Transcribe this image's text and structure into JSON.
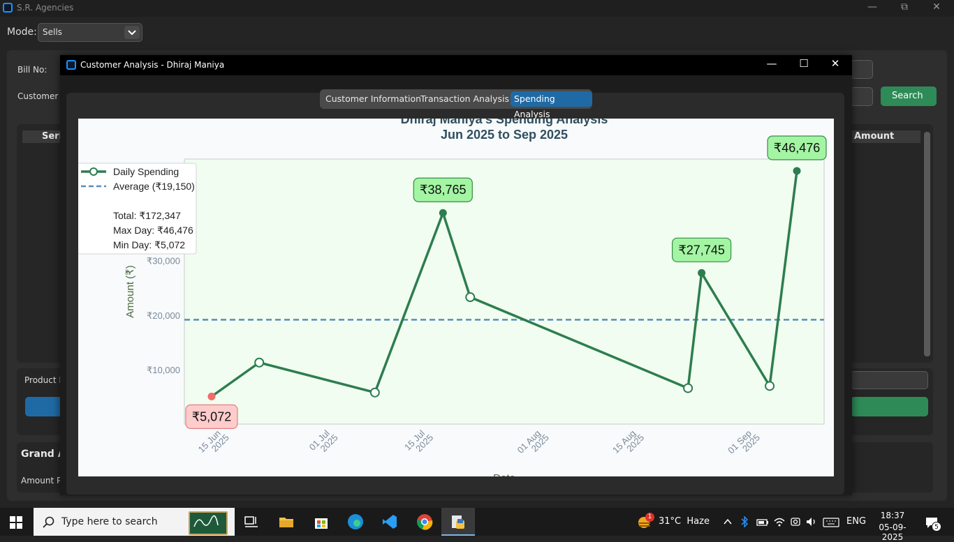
{
  "app": {
    "title": "S.R. Agencies"
  },
  "mode": {
    "label": "Mode:",
    "value": "Sells"
  },
  "background": {
    "bill_no_label": "Bill No:",
    "customer_label": "Customer I",
    "search_button": "Search",
    "serial_header": "Seri",
    "amount_header": "Amount",
    "product_label": "Product N",
    "grand_label": "Grand A",
    "amount_paid_label": "Amount P"
  },
  "dialog": {
    "title": "Customer Analysis - Dhiraj Maniya",
    "tabs": [
      {
        "label": "Customer Information",
        "active": false
      },
      {
        "label": "Transaction Analysis",
        "active": false
      },
      {
        "label": "Spending Analysis",
        "active": true
      }
    ]
  },
  "chart_data": {
    "type": "line",
    "title": "Dhiraj Maniya's Spending Analysis",
    "subtitle": "Jun 2025 to Sep 2025",
    "ylabel": "Amount (₹)",
    "xlabel": "Date",
    "ylim": [
      0,
      46476
    ],
    "y_ticks": [
      "₹10,000",
      "₹20,000",
      "₹30,000"
    ],
    "y_tick_values": [
      10000,
      20000,
      30000
    ],
    "x_ticks": [
      {
        "date": "2025-06-15",
        "label1": "15 Jun",
        "label2": "2025"
      },
      {
        "date": "2025-07-01",
        "label1": "01 Jul",
        "label2": "2025"
      },
      {
        "date": "2025-07-15",
        "label1": "15 Jul",
        "label2": "2025"
      },
      {
        "date": "2025-08-01",
        "label1": "01 Aug",
        "label2": "2025"
      },
      {
        "date": "2025-08-15",
        "label1": "15 Aug",
        "label2": "2025"
      },
      {
        "date": "2025-09-01",
        "label1": "01 Sep",
        "label2": "2025"
      }
    ],
    "x_range": [
      "2025-06-10",
      "2025-09-12"
    ],
    "points": [
      {
        "date": "2025-06-14",
        "value": 5072,
        "kind": "min"
      },
      {
        "date": "2025-06-21",
        "value": 11300,
        "kind": "normal"
      },
      {
        "date": "2025-07-08",
        "value": 5800,
        "kind": "normal"
      },
      {
        "date": "2025-07-18",
        "value": 38765,
        "kind": "peak"
      },
      {
        "date": "2025-07-22",
        "value": 23300,
        "kind": "normal"
      },
      {
        "date": "2025-08-23",
        "value": 6600,
        "kind": "normal"
      },
      {
        "date": "2025-08-25",
        "value": 27745,
        "kind": "peak"
      },
      {
        "date": "2025-09-04",
        "value": 7000,
        "kind": "normal"
      },
      {
        "date": "2025-09-08",
        "value": 46476,
        "kind": "peak"
      }
    ],
    "annotations": [
      {
        "date": "2025-06-14",
        "value": 5072,
        "text": "₹5,072",
        "style": "min"
      },
      {
        "date": "2025-07-18",
        "value": 38765,
        "text": "₹38,765",
        "style": "peak"
      },
      {
        "date": "2025-08-25",
        "value": 27745,
        "text": "₹27,745",
        "style": "peak"
      },
      {
        "date": "2025-09-08",
        "value": 46476,
        "text": "₹46,476",
        "style": "peak"
      }
    ],
    "average": 19150,
    "legend": {
      "position": "top-left",
      "series_label": "Daily Spending",
      "average_label": "Average (₹19,150)",
      "total": "Total: ₹172,347",
      "max_day": "Max Day: ₹46,476",
      "min_day": "Min Day: ₹5,072"
    },
    "colors": {
      "line": "#2e7d4f",
      "average": "#5b8db8",
      "plot_bg": "#f0fdf0",
      "peak_box": "#a3f5a3",
      "min_box": "#ffcccc",
      "min_dot": "#f26a6a"
    },
    "grid": false
  },
  "taskbar": {
    "search_placeholder": "Type here to search",
    "weather": "31°C  Haze",
    "lang": "ENG",
    "time": "18:37",
    "date": "05-09-2025",
    "notif_count": "5",
    "weather_badge": "1"
  }
}
